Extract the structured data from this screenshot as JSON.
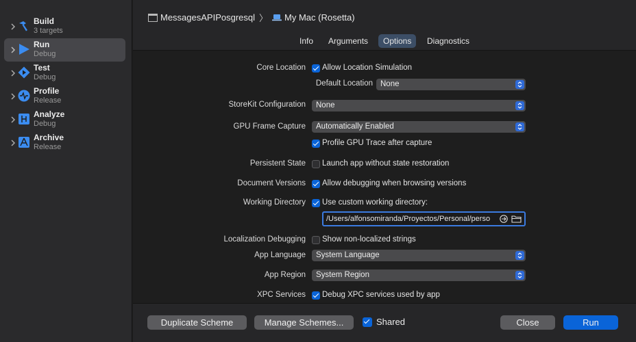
{
  "sidebar": {
    "items": [
      {
        "title": "Build",
        "subtitle": "3 targets",
        "icon": "hammer-icon"
      },
      {
        "title": "Run",
        "subtitle": "Debug",
        "icon": "play-icon",
        "selected": true
      },
      {
        "title": "Test",
        "subtitle": "Debug",
        "icon": "test-diamond-icon"
      },
      {
        "title": "Profile",
        "subtitle": "Release",
        "icon": "instruments-icon"
      },
      {
        "title": "Analyze",
        "subtitle": "Debug",
        "icon": "analyze-icon"
      },
      {
        "title": "Archive",
        "subtitle": "Release",
        "icon": "archive-icon"
      }
    ]
  },
  "header": {
    "scheme": "MessagesAPIPosgresql",
    "separator": "〉",
    "destination": "My Mac (Rosetta)"
  },
  "tabs": [
    {
      "label": "Info"
    },
    {
      "label": "Arguments"
    },
    {
      "label": "Options",
      "active": true
    },
    {
      "label": "Diagnostics"
    }
  ],
  "options": {
    "core_location": {
      "label": "Core Location",
      "checkbox": "Allow Location Simulation",
      "checked": true
    },
    "default_location": {
      "label": "Default Location",
      "value": "None"
    },
    "storekit": {
      "label": "StoreKit Configuration",
      "value": "None"
    },
    "gpu_frame_capture": {
      "label": "GPU Frame Capture",
      "value": "Automatically Enabled"
    },
    "gpu_profile": {
      "checkbox": "Profile GPU Trace after capture",
      "checked": true
    },
    "persistent_state": {
      "label": "Persistent State",
      "checkbox": "Launch app without state restoration",
      "checked": false
    },
    "document_versions": {
      "label": "Document Versions",
      "checkbox": "Allow debugging when browsing versions",
      "checked": true
    },
    "working_directory": {
      "label": "Working Directory",
      "checkbox": "Use custom working directory:",
      "checked": true,
      "path": "/Users/alfonsomiranda/Proyectos/Personal/perso"
    },
    "localization_debugging": {
      "label": "Localization Debugging",
      "checkbox": "Show non-localized strings",
      "checked": false
    },
    "app_language": {
      "label": "App Language",
      "value": "System Language"
    },
    "app_region": {
      "label": "App Region",
      "value": "System Region"
    },
    "xpc_services": {
      "label": "XPC Services",
      "checkbox": "Debug XPC services used by app",
      "checked": true
    }
  },
  "footer": {
    "duplicate": "Duplicate Scheme",
    "manage": "Manage Schemes...",
    "shared": "Shared",
    "shared_checked": true,
    "close": "Close",
    "run": "Run"
  },
  "colors": {
    "accent": "#0a64d8",
    "selected_tab": "#3c4e66",
    "sidebar_selected": "#46464a"
  }
}
